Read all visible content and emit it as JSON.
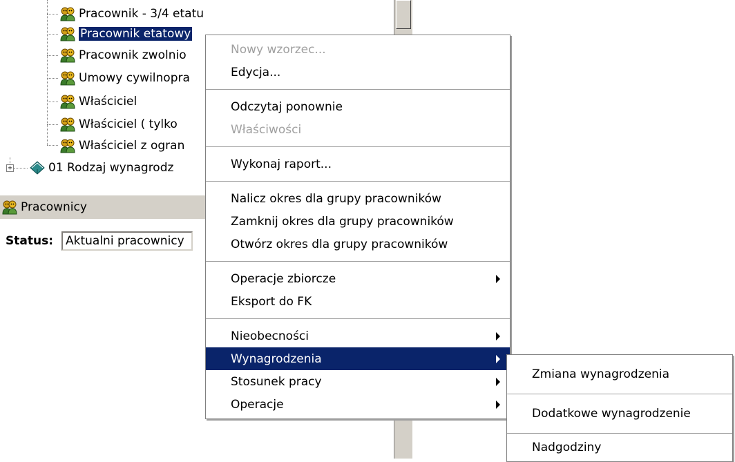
{
  "tree": {
    "items": [
      {
        "label": "Pracownik - 3/4 etatu",
        "icon": "user-group-icon"
      },
      {
        "label": "Pracownik etatowy",
        "icon": "user-group-icon",
        "selected": true
      },
      {
        "label": "Pracownik zwolnio",
        "icon": "user-group-icon"
      },
      {
        "label": "Umowy cywilnopra",
        "icon": "user-group-icon"
      },
      {
        "label": "Właściciel",
        "icon": "user-group-icon"
      },
      {
        "label": "Właściciel ( tylko",
        "icon": "user-group-icon"
      },
      {
        "label": "Właściciel z ogran",
        "icon": "user-group-icon"
      },
      {
        "label": "01 Rodzaj wynagrodz",
        "icon": "book-icon"
      }
    ]
  },
  "pane": {
    "title": "Pracownicy",
    "status_label": "Status:",
    "status_value": "Aktualni pracownicy"
  },
  "context_menu": {
    "items": [
      {
        "label": "Nowy wzorzec...",
        "disabled": true
      },
      {
        "label": "Edycja..."
      },
      {
        "label": "Odczytaj ponownie"
      },
      {
        "label": "Właściwości",
        "disabled": true
      },
      {
        "label": "Wykonaj raport..."
      },
      {
        "label": "Nalicz okres dla grupy pracowników"
      },
      {
        "label": "Zamknij okres dla grupy pracowników"
      },
      {
        "label": "Otwórz okres dla grupy pracowników"
      },
      {
        "label": "Operacje zbiorcze",
        "submenu": true
      },
      {
        "label": "Eksport do FK"
      },
      {
        "label": "Nieobecności",
        "submenu": true
      },
      {
        "label": "Wynagrodzenia",
        "submenu": true,
        "highlighted": true
      },
      {
        "label": "Stosunek pracy",
        "submenu": true
      },
      {
        "label": "Operacje",
        "submenu": true
      }
    ]
  },
  "submenu": {
    "items": [
      {
        "label": "Zmiana wynagrodzenia"
      },
      {
        "label": "Dodatkowe wynagrodzenie"
      },
      {
        "label": "Nadgodziny"
      }
    ]
  },
  "colors": {
    "highlight": "#0a246a",
    "panel": "#d4d0c8",
    "disabled_text": "#a0a0a0"
  }
}
